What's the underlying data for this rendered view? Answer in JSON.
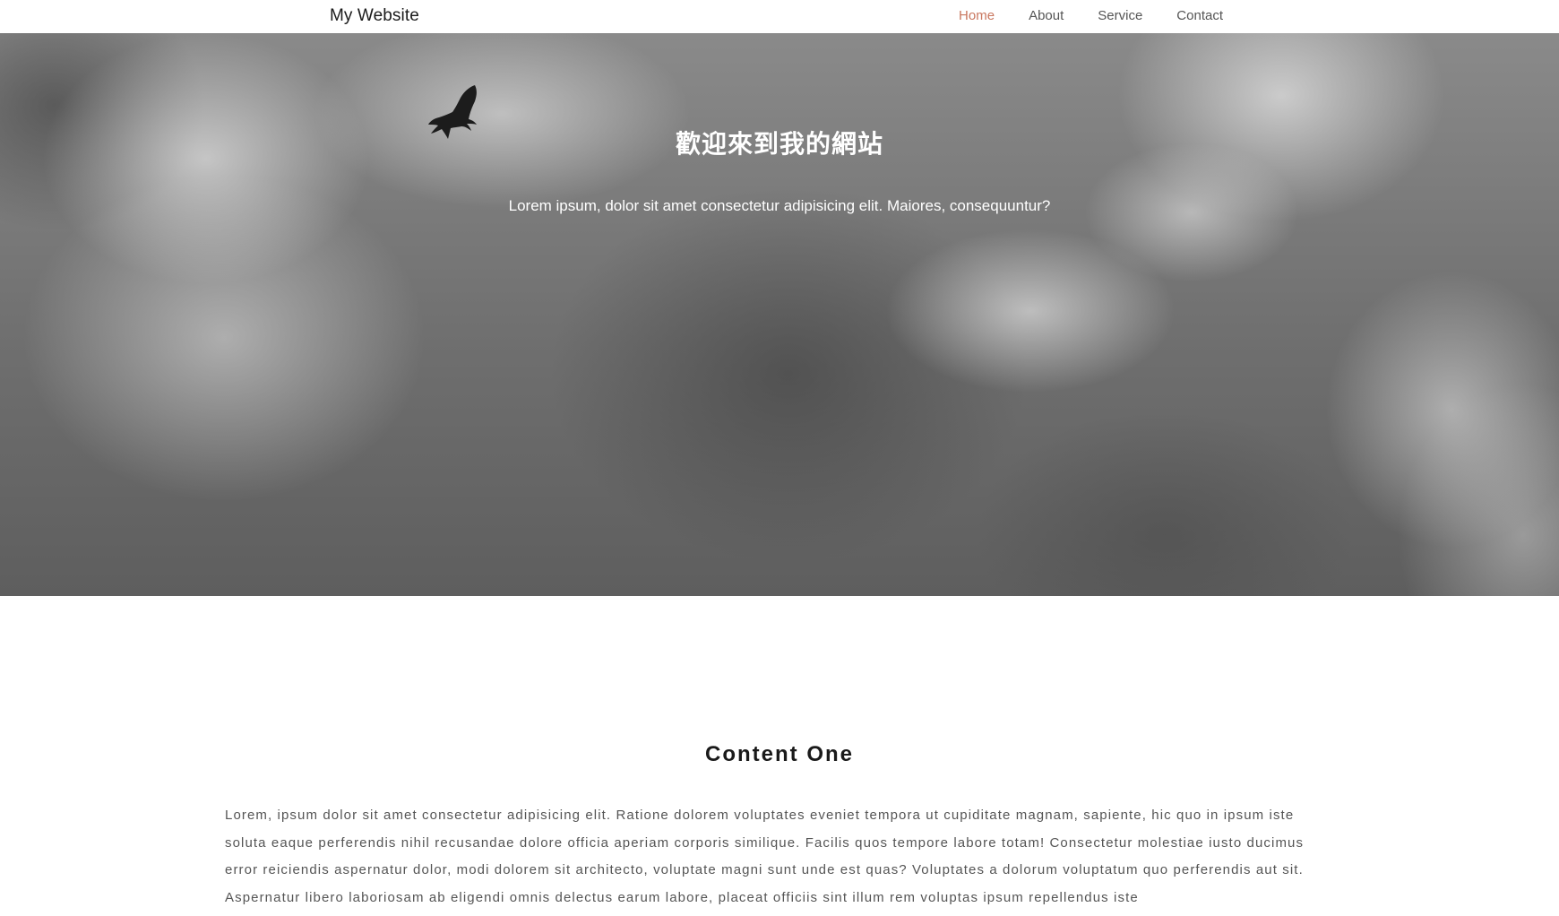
{
  "header": {
    "brand": "My Website",
    "nav": [
      {
        "label": "Home",
        "active": true
      },
      {
        "label": "About",
        "active": false
      },
      {
        "label": "Service",
        "active": false
      },
      {
        "label": "Contact",
        "active": false
      }
    ],
    "active_color": "#c9775f"
  },
  "hero": {
    "title": "歡迎來到我的網站",
    "subtitle": "Lorem ipsum, dolor sit amet consectetur adipisicing elit. Maiores, consequuntur?",
    "background_image": "black-and-white cloudy sky with a flying bird",
    "icon": "bird-icon"
  },
  "content_one": {
    "title": "Content One",
    "body": "Lorem, ipsum dolor sit amet consectetur adipisicing elit. Ratione dolorem voluptates eveniet tempora ut cupiditate magnam, sapiente, hic quo in ipsum iste soluta eaque perferendis nihil recusandae dolore officia aperiam corporis similique. Facilis quos tempore labore totam! Consectetur molestiae iusto ducimus error reiciendis aspernatur dolor, modi dolorem sit architecto, voluptate magni sunt unde est quas? Voluptates a dolorum voluptatum quo perferendis aut sit. Aspernatur libero laboriosam ab eligendi omnis delectus earum labore, placeat officiis sint illum rem voluptas ipsum repellendus iste"
  }
}
